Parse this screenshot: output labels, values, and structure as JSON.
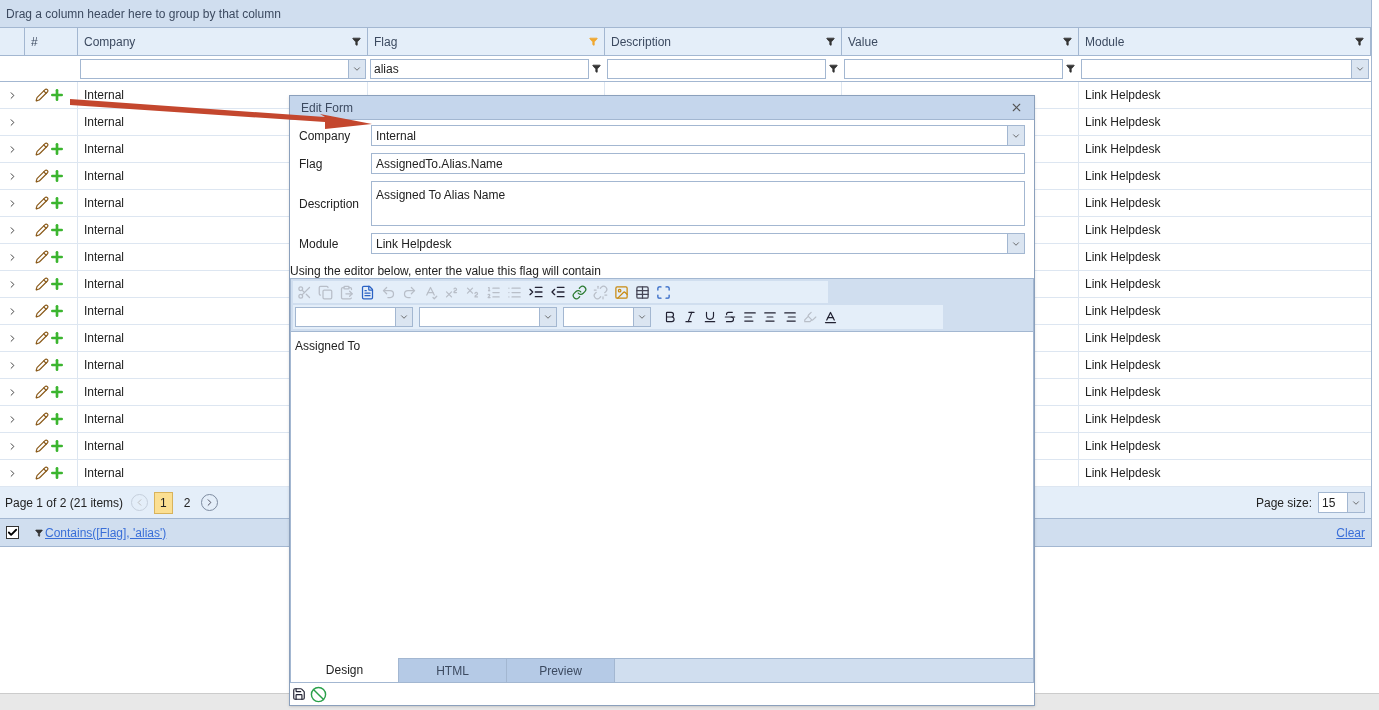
{
  "group_panel": {
    "text": "Drag a column header here to group by that column"
  },
  "columns": [
    {
      "label": "#",
      "kind": "index"
    },
    {
      "label": "Company",
      "kind": "data",
      "filtered": false
    },
    {
      "label": "Flag",
      "kind": "data",
      "filtered": true
    },
    {
      "label": "Description",
      "kind": "data",
      "filtered": false
    },
    {
      "label": "Value",
      "kind": "data",
      "filtered": false
    },
    {
      "label": "Module",
      "kind": "data",
      "filtered": false
    }
  ],
  "filter_row": [
    {
      "kind": "combo"
    },
    {
      "kind": "text",
      "value": "alias"
    },
    {
      "kind": "text"
    },
    {
      "kind": "text"
    },
    {
      "kind": "combo"
    }
  ],
  "rows": [
    {
      "actions": true,
      "company": "Internal",
      "module": "Link Helpdesk"
    },
    {
      "actions": false,
      "company": "Internal",
      "module": "Link Helpdesk"
    },
    {
      "actions": true,
      "company": "Internal",
      "module": "Link Helpdesk"
    },
    {
      "actions": true,
      "company": "Internal",
      "module": "Link Helpdesk"
    },
    {
      "actions": true,
      "company": "Internal",
      "module": "Link Helpdesk"
    },
    {
      "actions": true,
      "company": "Internal",
      "module": "Link Helpdesk"
    },
    {
      "actions": true,
      "company": "Internal",
      "module": "Link Helpdesk"
    },
    {
      "actions": true,
      "company": "Internal",
      "module": "Link Helpdesk"
    },
    {
      "actions": true,
      "company": "Internal",
      "module": "Link Helpdesk"
    },
    {
      "actions": true,
      "company": "Internal",
      "module": "Link Helpdesk"
    },
    {
      "actions": true,
      "company": "Internal",
      "module": "Link Helpdesk"
    },
    {
      "actions": true,
      "company": "Internal",
      "module": "Link Helpdesk"
    },
    {
      "actions": true,
      "company": "Internal",
      "module": "Link Helpdesk"
    },
    {
      "actions": true,
      "company": "Internal",
      "module": "Link Helpdesk"
    },
    {
      "actions": true,
      "company": "Internal",
      "module": "Link Helpdesk"
    }
  ],
  "pager": {
    "summary": "Page 1 of 2 (21 items)",
    "pages": [
      {
        "label": "1",
        "selected": true
      },
      {
        "label": "2",
        "selected": false
      }
    ],
    "page_size_label": "Page size:",
    "page_size": "15"
  },
  "filter_bar": {
    "enabled": true,
    "expression": "Contains([Flag], 'alias')",
    "clear": "Clear"
  },
  "dialog": {
    "title": "Edit Form",
    "fields": [
      {
        "label": "Company",
        "kind": "combo",
        "value": "Internal"
      },
      {
        "label": "Flag",
        "kind": "text",
        "value": "AssignedTo.Alias.Name"
      },
      {
        "label": "Description",
        "kind": "memo",
        "value": "Assigned To Alias Name"
      },
      {
        "label": "Module",
        "kind": "combo",
        "value": "Link Helpdesk"
      }
    ],
    "hint": "Using the editor below, enter the value this flag will contain",
    "editor_content": "Assigned To",
    "tabs": [
      {
        "label": "Design",
        "selected": true
      },
      {
        "label": "HTML",
        "selected": false
      },
      {
        "label": "Preview",
        "selected": false
      }
    ]
  }
}
